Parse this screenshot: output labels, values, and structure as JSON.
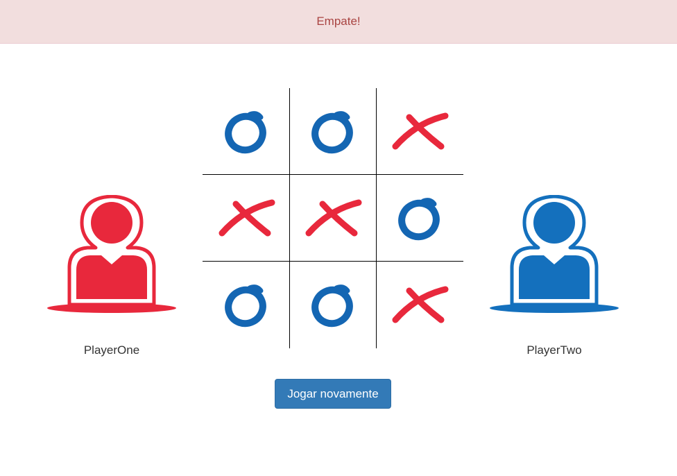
{
  "status": {
    "message": "Empate!"
  },
  "players": {
    "one": {
      "name": "PlayerOne",
      "color": "#e8283c",
      "icon": "person-icon"
    },
    "two": {
      "name": "PlayerTwo",
      "color": "#1470bd",
      "icon": "person-icon"
    }
  },
  "board": {
    "cells": [
      [
        "O",
        "O",
        "X"
      ],
      [
        "X",
        "X",
        "O"
      ],
      [
        "O",
        "O",
        "X"
      ]
    ],
    "mark_colors": {
      "O": "#1466b3",
      "X": "#e8283c"
    }
  },
  "actions": {
    "play_again_label": "Jogar novamente"
  }
}
